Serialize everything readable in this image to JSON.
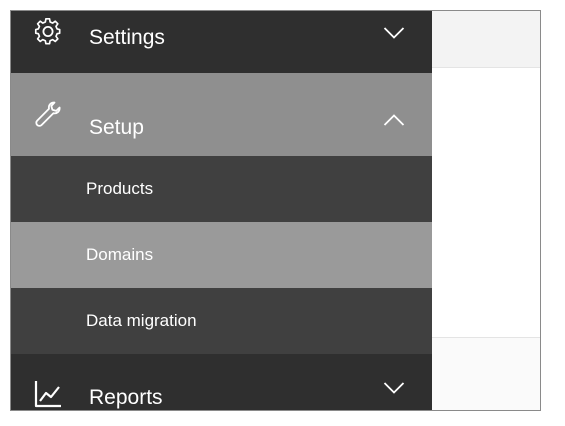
{
  "nav": {
    "settings": {
      "label": "Settings",
      "icon": "gear-icon",
      "expanded": false
    },
    "setup": {
      "label": "Setup",
      "icon": "wrench-icon",
      "expanded": true,
      "subitems": [
        {
          "label": "Products",
          "selected": false
        },
        {
          "label": "Domains",
          "selected": true
        },
        {
          "label": "Data migration",
          "selected": false
        }
      ]
    },
    "reports": {
      "label": "Reports",
      "icon": "line-chart-icon",
      "expanded": false
    }
  },
  "colors": {
    "nav_background": "#2f2f2f",
    "nav_expanded_header": "#8f8f8f",
    "subitem_background": "#404040",
    "subitem_selected": "#9a9a9a",
    "text": "#ffffff",
    "content_background": "#f3f3f3"
  }
}
